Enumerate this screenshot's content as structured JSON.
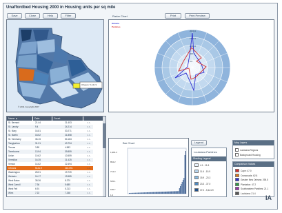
{
  "app": {
    "title": "Unaffordbed Housing 2000 in Housing units per sq mile",
    "buttons": [
      "Save",
      "Close",
      "Help",
      "Filter"
    ],
    "radar_label": "Radar Chart",
    "radar_buttons": [
      "Print",
      "Print Preview"
    ]
  },
  "map": {
    "callout": "Orleans: 5,141.9",
    "footer": "© 2011 Copyright 2007"
  },
  "radar": {
    "legend": [
      {
        "label": "Orleans",
        "color": "#2d2dd1"
      },
      {
        "label": "Parishes",
        "color": "#d62d2d"
      }
    ],
    "ring_labels": [
      "2000.0",
      "1500.0",
      "1000.0",
      "500.0",
      "0.0"
    ],
    "levels": 5
  },
  "table": {
    "columns": [
      "Name ▲",
      "Date",
      "Count",
      ""
    ],
    "rows": [
      {
        "name": "St. Bernard",
        "date": "21.44",
        "count": "21.403",
        "sparkicon": "sparkline-icon"
      },
      {
        "name": "St. Landry",
        "date": "9.4",
        "count": "24.214",
        "sparkicon": "sparkline-icon"
      },
      {
        "name": "St. Mary",
        "date": "16.81",
        "count": "30.271",
        "sparkicon": "sparkline-icon"
      },
      {
        "name": "St. Martin",
        "date": "18.52",
        "count": "21.858",
        "sparkicon": "sparkline-icon"
      },
      {
        "name": "St. Tammany",
        "date": "36.15",
        "count": "54.184",
        "sparkicon": "sparkline-icon"
      },
      {
        "name": "Tangipahoa",
        "date": "31.31",
        "count": "43.794",
        "sparkicon": "sparkline-icon"
      },
      {
        "name": "Tensas",
        "date": "3.89",
        "count": "4.583",
        "sparkicon": "sparkline-icon"
      },
      {
        "name": "Terrebonne",
        "date": "13.94",
        "count": "39.859",
        "sparkicon": "sparkline-icon"
      },
      {
        "name": "Union",
        "date": "10.62",
        "count": "10.559",
        "sparkicon": "sparkline-icon"
      },
      {
        "name": "Vermilion",
        "date": "16.35",
        "count": "21.425",
        "sparkicon": "sparkline-icon"
      },
      {
        "name": "Vernon",
        "date": "14.62",
        "count": "22.494",
        "sparkicon": "sparkline-icon"
      },
      {
        "name": "Orleans",
        "date": "5141.9",
        "count": "215.091",
        "sparkicon": "sparkline-icon"
      },
      {
        "name": "Washington",
        "date": "28.51",
        "count": "19.739",
        "sparkicon": "sparkline-icon"
      },
      {
        "name": "Webster",
        "date": "16.17",
        "count": "19.585",
        "sparkicon": "sparkline-icon"
      },
      {
        "name": "West Baton",
        "date": "38.36",
        "count": "8.370",
        "sparkicon": "sparkline-icon"
      },
      {
        "name": "West Carroll",
        "date": "7.36",
        "count": "5.685",
        "sparkicon": "sparkline-icon"
      },
      {
        "name": "West Feli",
        "date": "6.91",
        "count": "5.213",
        "sparkicon": "sparkline-icon"
      },
      {
        "name": "Winn",
        "date": "7.22",
        "count": "7.248",
        "sparkicon": "sparkline-icon"
      }
    ]
  },
  "barchart": {
    "title": "Bar Chart",
    "legend_button": "Legend",
    "y_ticks": [
      "1,981.3",
      "894.2",
      "714.3",
      "535.1",
      "186.7",
      "1.2"
    ]
  },
  "legend_panel": {
    "title": "Louisiana Parishes",
    "subtitle": "Shading Legend",
    "items": [
      {
        "label": "4.1 - 11.6",
        "color": "#e8f2fb"
      },
      {
        "label": "11.6 - 15.9",
        "color": "#b9d7f0"
      },
      {
        "label": "15.9 - 23.3",
        "color": "#86b8e0"
      },
      {
        "label": "23.3 - 37.0",
        "color": "#4f89c0"
      },
      {
        "label": "37.0 - 5,141.9",
        "color": "#1f4f8a"
      }
    ]
  },
  "map_layers": {
    "title": "Map Layers",
    "options": [
      "Louisiana Regions",
      "Background Housing"
    ]
  },
  "comparison": {
    "title": "Comparison Values",
    "items": [
      {
        "label": "Cape: 47.0",
        "color": "#d62d2d"
      },
      {
        "label": "Crossroads: 62.8",
        "color": "#e07a1c"
      },
      {
        "label": "Greater New Orleans: 295.5",
        "color": "#2d2dd1"
      },
      {
        "label": "Plantation: 47.2",
        "color": "#2f9a45"
      },
      {
        "label": "Southeastern Parishes: 21.1",
        "color": "#9933aa"
      },
      {
        "label": "Louisiana: 21.4",
        "color": "#555555"
      }
    ]
  },
  "logo": "IA"
}
